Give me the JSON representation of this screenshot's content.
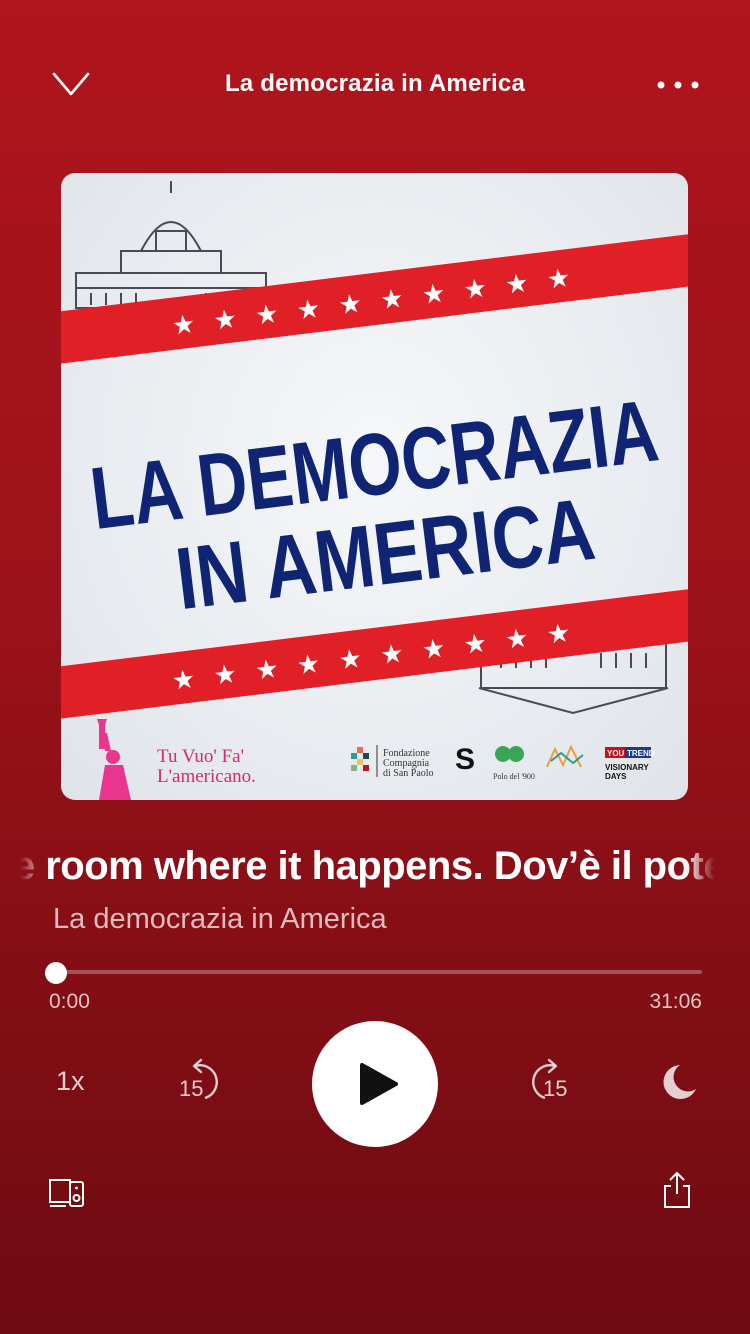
{
  "header": {
    "title": "La democrazia in America",
    "collapse_icon": "chevron-down-icon",
    "more_icon": "more-horizontal-icon"
  },
  "artwork": {
    "line1": "LA DEMOCRAZIA",
    "line2": "IN AMERICA",
    "brand_line1": "Tu Vuo' Fa'",
    "brand_line2": "L'americano.",
    "sponsor_fondazione_1": "Fondazione",
    "sponsor_fondazione_2": "Compagnia",
    "sponsor_fondazione_3": "di San Paolo",
    "sponsor_polo": "Polo del '900",
    "sponsor_youtrend_badge_1": "YOU",
    "sponsor_youtrend_badge_2": "TREND",
    "sponsor_visionary_1": "VISIONARY",
    "sponsor_visionary_2": "DAYS",
    "colors": {
      "navy": "#0f2472",
      "red": "#e11f27"
    }
  },
  "track": {
    "title": "The room where it happens. Dov’è il potere",
    "show": "La democrazia in America"
  },
  "progress": {
    "elapsed": "0:00",
    "total": "31:06",
    "fraction": 0
  },
  "controls": {
    "speed_label": "1x",
    "skip_back_label": "15",
    "skip_forward_label": "15",
    "play_icon": "play-icon",
    "sleep_icon": "moon-icon",
    "devices_icon": "devices-icon",
    "share_icon": "share-icon"
  }
}
